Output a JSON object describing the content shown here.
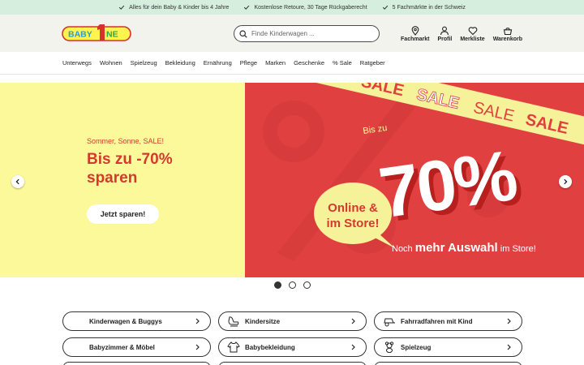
{
  "topbar": {
    "usps": [
      {
        "text": "Alles für dein Baby & Kinder bis 4 Jahre",
        "icon": "check-icon"
      },
      {
        "text": "Kostenlose Retoure, 30 Tage Rückgaberecht",
        "icon": "check-icon"
      },
      {
        "text": "5 Fachmärkte in der Schweiz",
        "icon": "check-icon"
      }
    ]
  },
  "header": {
    "logo_text": "BABY ONE",
    "search_placeholder": "Finde Kinderwagen ...",
    "actions": [
      {
        "label": "Fachmarkt",
        "icon": "location-pin-icon"
      },
      {
        "label": "Profil",
        "icon": "user-icon"
      },
      {
        "label": "Merkliste",
        "icon": "heart-icon"
      },
      {
        "label": "Warenkorb",
        "icon": "basket-icon"
      }
    ]
  },
  "nav": {
    "items": [
      "Unterwegs",
      "Wohnen",
      "Spielzeug",
      "Bekleidung",
      "Ernährung",
      "Pflege",
      "Marken",
      "Geschenke",
      "% Sale",
      "Ratgeber"
    ]
  },
  "hero": {
    "kicker": "Sommer, Sonne, SALE!",
    "title": "Bis zu -70% sparen",
    "cta": "Jetzt sparen!",
    "banner": {
      "sale_word": "SALE",
      "bis_zu": "Bis zu",
      "discount": "-70%",
      "bubble_line1": "Online &",
      "bubble_line2": "im Store!",
      "tagline_pre": "Noch",
      "tagline_bold": "mehr Auswahl",
      "tagline_post": "im Store!"
    },
    "slides": {
      "count": 3,
      "active": 1
    }
  },
  "categories": [
    {
      "label": "Kinderwagen & Buggys",
      "icon": ""
    },
    {
      "label": "Kindersitze",
      "icon": "car-seat-icon"
    },
    {
      "label": "Fahrradfahren mit Kind",
      "icon": "bike-trailer-icon"
    },
    {
      "label": "Babyzimmer & Möbel",
      "icon": ""
    },
    {
      "label": "Babybekleidung",
      "icon": "baby-clothes-icon"
    },
    {
      "label": "Spielzeug",
      "icon": "teddy-bear-icon"
    }
  ],
  "colors": {
    "topbar": "#d6eedd",
    "header": "#f3f3ee",
    "hero_yellow": "#fbf99a",
    "hero_red": "#e0403f",
    "accent_red": "#d33a2e",
    "sale_yellow": "#f6f29a"
  }
}
